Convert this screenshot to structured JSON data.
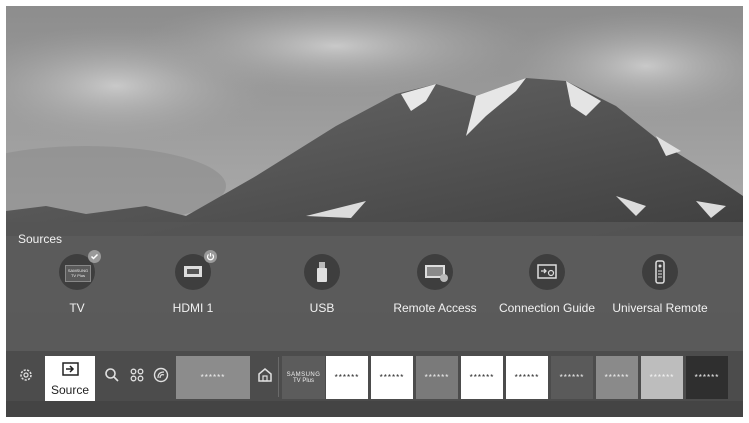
{
  "sources": {
    "title": "Sources",
    "items": [
      {
        "label": "TV",
        "icon": "samsung-tv-plus-icon",
        "badge": "check-icon"
      },
      {
        "label": "HDMI 1",
        "icon": "hdmi-icon",
        "badge": "power-icon"
      },
      {
        "label": "USB",
        "icon": "usb-icon"
      },
      {
        "label": "Remote Access",
        "icon": "remote-access-icon"
      },
      {
        "label": "Connection Guide",
        "icon": "connection-guide-icon"
      },
      {
        "label": "Universal Remote",
        "icon": "universal-remote-icon"
      }
    ],
    "tv_logo_line1": "SAMSUNG",
    "tv_logo_line2": "TV Plus"
  },
  "bottom_bar": {
    "source_label": "Source",
    "icons": [
      "settings-icon",
      "source-icon",
      "search-icon",
      "apps-icon",
      "ambient-icon",
      "home-icon"
    ],
    "wide_tile_label": "******",
    "tv_plus_line1": "SAMSUNG",
    "tv_plus_line2": "TV Plus",
    "tiles": [
      {
        "label": "******",
        "bg": "#ffffff",
        "fg": "#222222"
      },
      {
        "label": "******",
        "bg": "#ffffff",
        "fg": "#222222"
      },
      {
        "label": "******",
        "bg": "#7a7a7a",
        "fg": "#f0f0f0"
      },
      {
        "label": "******",
        "bg": "#ffffff",
        "fg": "#222222"
      },
      {
        "label": "******",
        "bg": "#ffffff",
        "fg": "#222222"
      },
      {
        "label": "******",
        "bg": "#5a5a5a",
        "fg": "#f0f0f0"
      },
      {
        "label": "******",
        "bg": "#8a8a8a",
        "fg": "#f0f0f0"
      },
      {
        "label": "******",
        "bg": "#bdbdbd",
        "fg": "#f5f5f5"
      },
      {
        "label": "******",
        "bg": "#2f2f2f",
        "fg": "#f0f0f0"
      }
    ]
  }
}
